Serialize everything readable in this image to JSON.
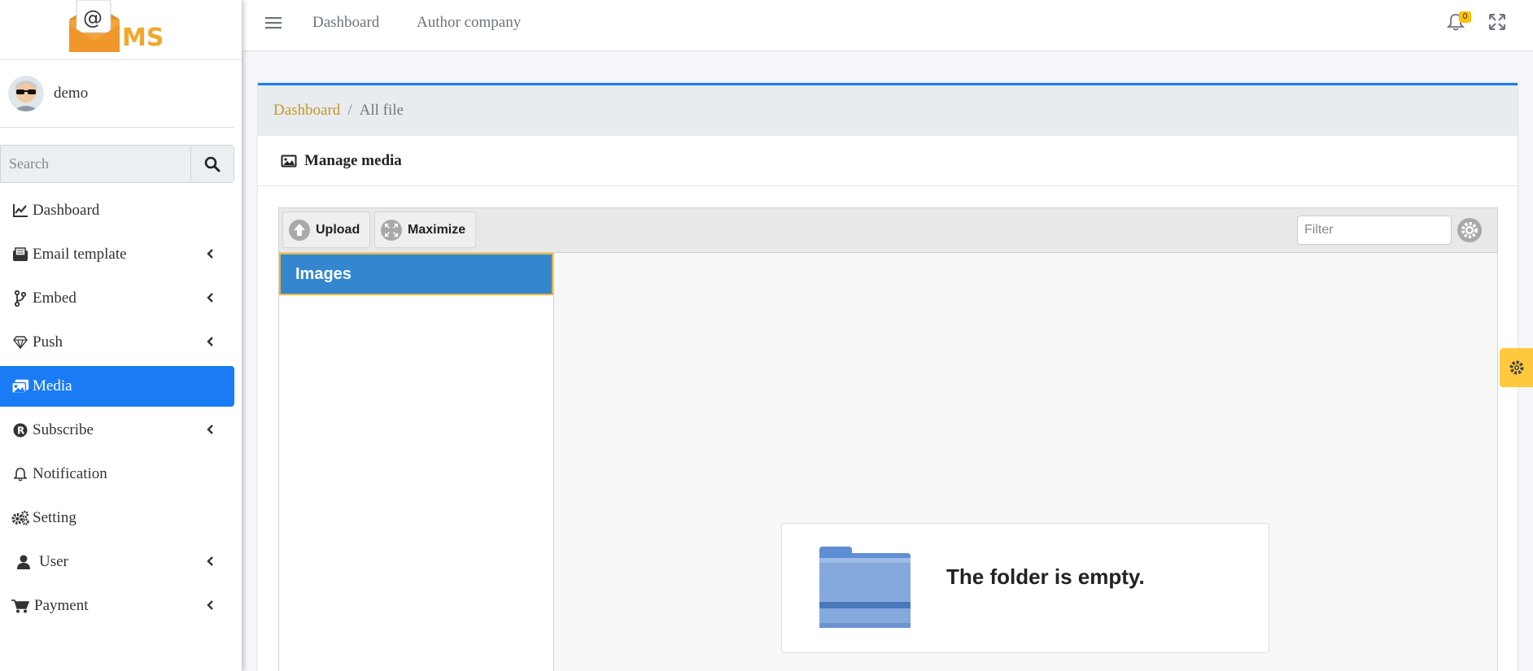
{
  "brand": {
    "logo_text": "MS",
    "logo_symbol": "@"
  },
  "user": {
    "name": "demo"
  },
  "search": {
    "placeholder": "Search"
  },
  "sidebar": {
    "items": [
      {
        "label": "Dashboard",
        "icon": "chart-line-icon",
        "has_submenu": false,
        "active": false
      },
      {
        "label": "Email template",
        "icon": "envelope-open-icon",
        "has_submenu": true,
        "active": false
      },
      {
        "label": "Embed",
        "icon": "code-branch-icon",
        "has_submenu": true,
        "active": false
      },
      {
        "label": "Push",
        "icon": "gem-icon",
        "has_submenu": true,
        "active": false
      },
      {
        "label": "Media",
        "icon": "images-icon",
        "has_submenu": false,
        "active": true
      },
      {
        "label": "Subscribe",
        "icon": "registered-icon",
        "has_submenu": true,
        "active": false
      },
      {
        "label": "Notification",
        "icon": "bell-icon",
        "has_submenu": false,
        "active": false
      },
      {
        "label": "Setting",
        "icon": "cogs-icon",
        "has_submenu": false,
        "active": false
      },
      {
        "label": "User",
        "icon": "user-icon",
        "has_submenu": true,
        "active": false
      },
      {
        "label": "Payment",
        "icon": "shopping-cart-icon",
        "has_submenu": true,
        "active": false
      }
    ]
  },
  "topbar": {
    "links": [
      "Dashboard",
      "Author company"
    ],
    "notification_count": "0"
  },
  "breadcrumb": {
    "home": "Dashboard",
    "separator": "/",
    "current": "All file"
  },
  "card": {
    "title": "Manage media"
  },
  "file_manager": {
    "toolbar": {
      "upload": "Upload",
      "maximize": "Maximize",
      "filter_placeholder": "Filter"
    },
    "folders": [
      "Images"
    ],
    "empty_message": "The folder is empty."
  },
  "colors": {
    "primary": "#1a7cf4",
    "accent": "#ffc107",
    "breadcrumb_link": "#c4972a",
    "tree_selected": "#3487cf"
  }
}
